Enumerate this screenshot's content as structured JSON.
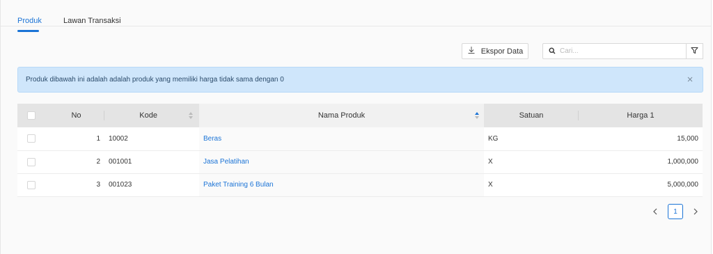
{
  "tabs": [
    {
      "label": "Produk",
      "active": true
    },
    {
      "label": "Lawan Transaksi",
      "active": false
    }
  ],
  "toolbar": {
    "export_label": "Ekspor Data",
    "export_icon": "download-icon",
    "search_placeholder": "Cari...",
    "search_value": "",
    "search_icon": "search-icon",
    "filter_icon": "filter-icon"
  },
  "alert": {
    "text": "Produk dibawah ini adalah adalah produk yang memiliki harga tidak sama dengan 0",
    "close_icon": "close-icon"
  },
  "table": {
    "headers": {
      "no": "No",
      "kode": "Kode",
      "nama_produk": "Nama Produk",
      "satuan": "Satuan",
      "harga1": "Harga 1"
    },
    "sorted_column": "nama_produk",
    "rows": [
      {
        "no": "1",
        "kode": "10002",
        "nama_produk": "Beras",
        "satuan": "KG",
        "harga1": "15,000"
      },
      {
        "no": "2",
        "kode": "001001",
        "nama_produk": "Jasa Pelatihan",
        "satuan": "X",
        "harga1": "1,000,000"
      },
      {
        "no": "3",
        "kode": "001023",
        "nama_produk": "Paket Training 6 Bulan",
        "satuan": "X",
        "harga1": "5,000,000"
      }
    ]
  },
  "pagination": {
    "current_page": "1",
    "prev_icon": "chevron-left-icon",
    "next_icon": "chevron-right-icon"
  },
  "colors": {
    "accent": "#1a73d6",
    "alert_bg": "#cfe6fb",
    "header_bg": "#e4e4e4"
  }
}
